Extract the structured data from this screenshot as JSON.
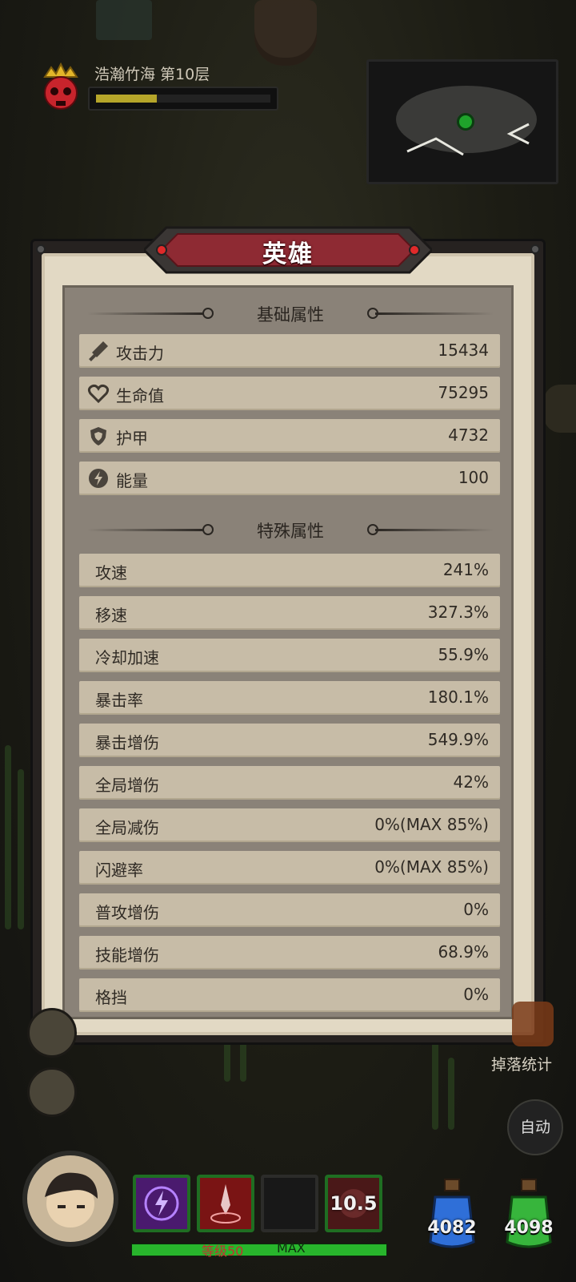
{
  "stage": {
    "title": "浩瀚竹海 第10层",
    "progress": 0.35
  },
  "panel": {
    "title": "英雄",
    "basic_section": "基础属性",
    "special_section": "特殊属性",
    "basic_stats": [
      {
        "icon": "sword-icon",
        "label": "攻击力",
        "value": "15434"
      },
      {
        "icon": "heart-icon",
        "label": "生命值",
        "value": "75295"
      },
      {
        "icon": "shield-icon",
        "label": "护甲",
        "value": "4732"
      },
      {
        "icon": "energy-icon",
        "label": "能量",
        "value": "100"
      }
    ],
    "special_stats": [
      {
        "label": "攻速",
        "value": "241%"
      },
      {
        "label": "移速",
        "value": "327.3%"
      },
      {
        "label": "冷却加速",
        "value": "55.9%"
      },
      {
        "label": "暴击率",
        "value": "180.1%"
      },
      {
        "label": "暴击增伤",
        "value": "549.9%"
      },
      {
        "label": "全局增伤",
        "value": "42%"
      },
      {
        "label": "全局减伤",
        "value": "0%(MAX 85%)"
      },
      {
        "label": "闪避率",
        "value": "0%(MAX 85%)"
      },
      {
        "label": "普攻增伤",
        "value": "0%"
      },
      {
        "label": "技能增伤",
        "value": "68.9%"
      },
      {
        "label": "格挡",
        "value": "0%"
      }
    ]
  },
  "hud": {
    "drop_stats_label": "掉落统计",
    "auto_label": "自动",
    "skill_cooldown": "10.5",
    "level_label": "等级50",
    "max_label": "MAX",
    "xp_progress": 1.0,
    "blue_potion_count": "4082",
    "green_potion_count": "4098"
  },
  "colors": {
    "banner_red": "#8e2a33",
    "paper": "#e2d9c4",
    "row_bg": "#c7bca7",
    "xp_green": "#28b52c"
  }
}
